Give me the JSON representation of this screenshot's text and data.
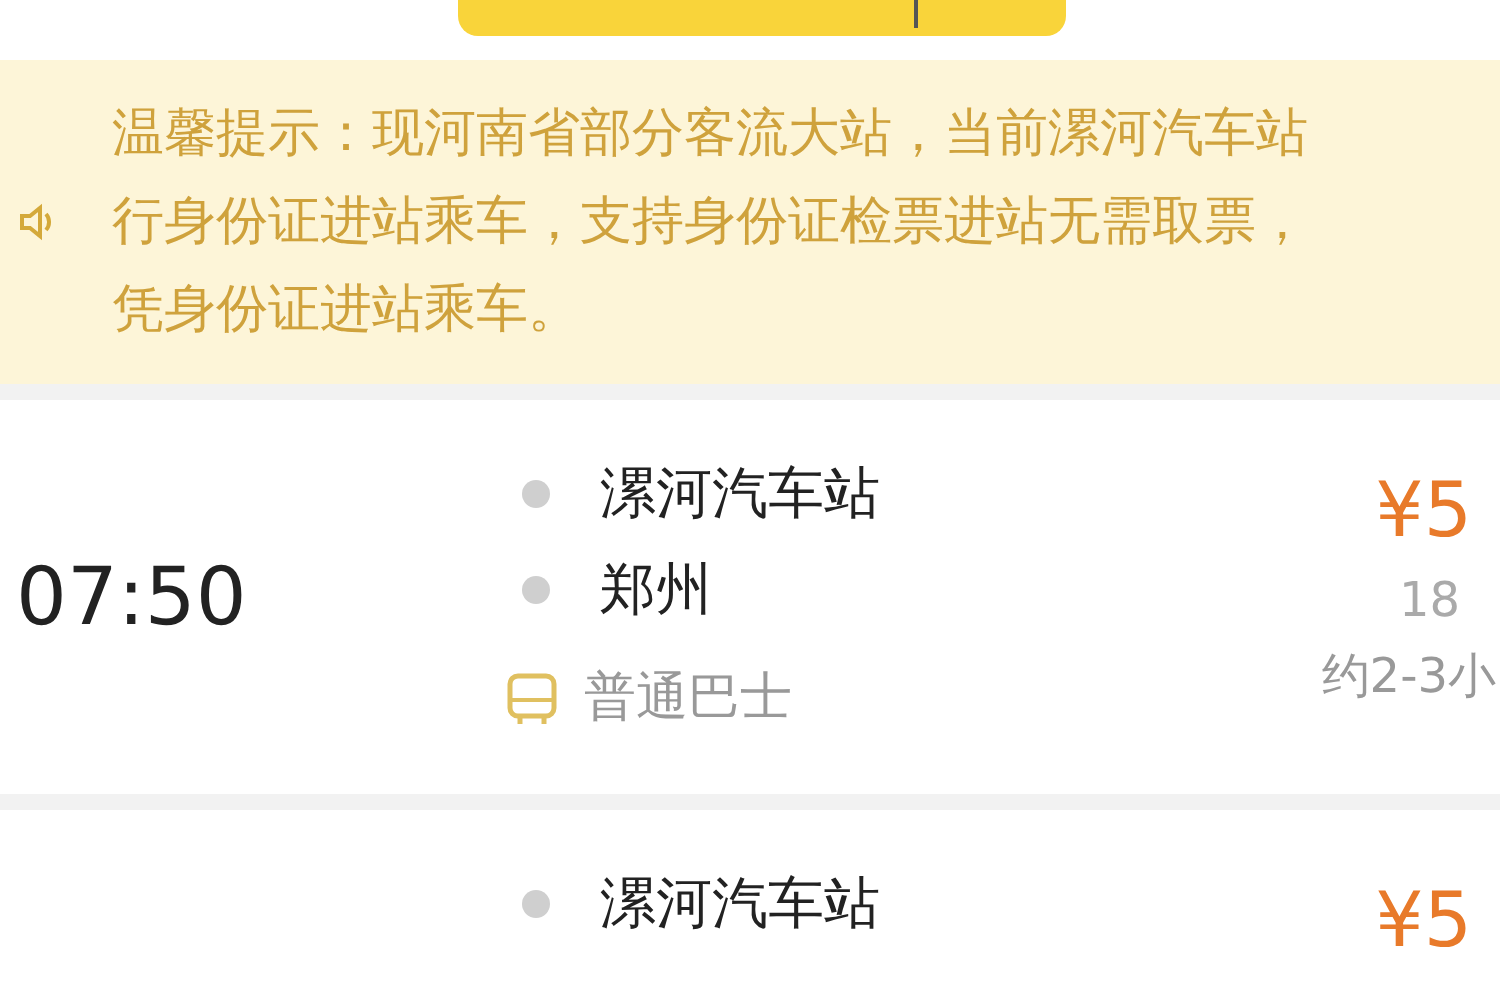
{
  "notice": {
    "lines": [
      "温馨提示：现河南省部分客流大站，当前漯河汽车站",
      "行身份证进站乘车，支持身份证检票进站无需取票，",
      "凭身份证进站乘车。"
    ]
  },
  "trips": [
    {
      "time": "07:50",
      "from": "漯河汽车站",
      "to": "郑州",
      "bus_type": "普通巴士",
      "price": "¥5",
      "seats": "18",
      "duration": "约2-3小"
    },
    {
      "from": "漯河汽车站",
      "price": "¥5"
    }
  ]
}
